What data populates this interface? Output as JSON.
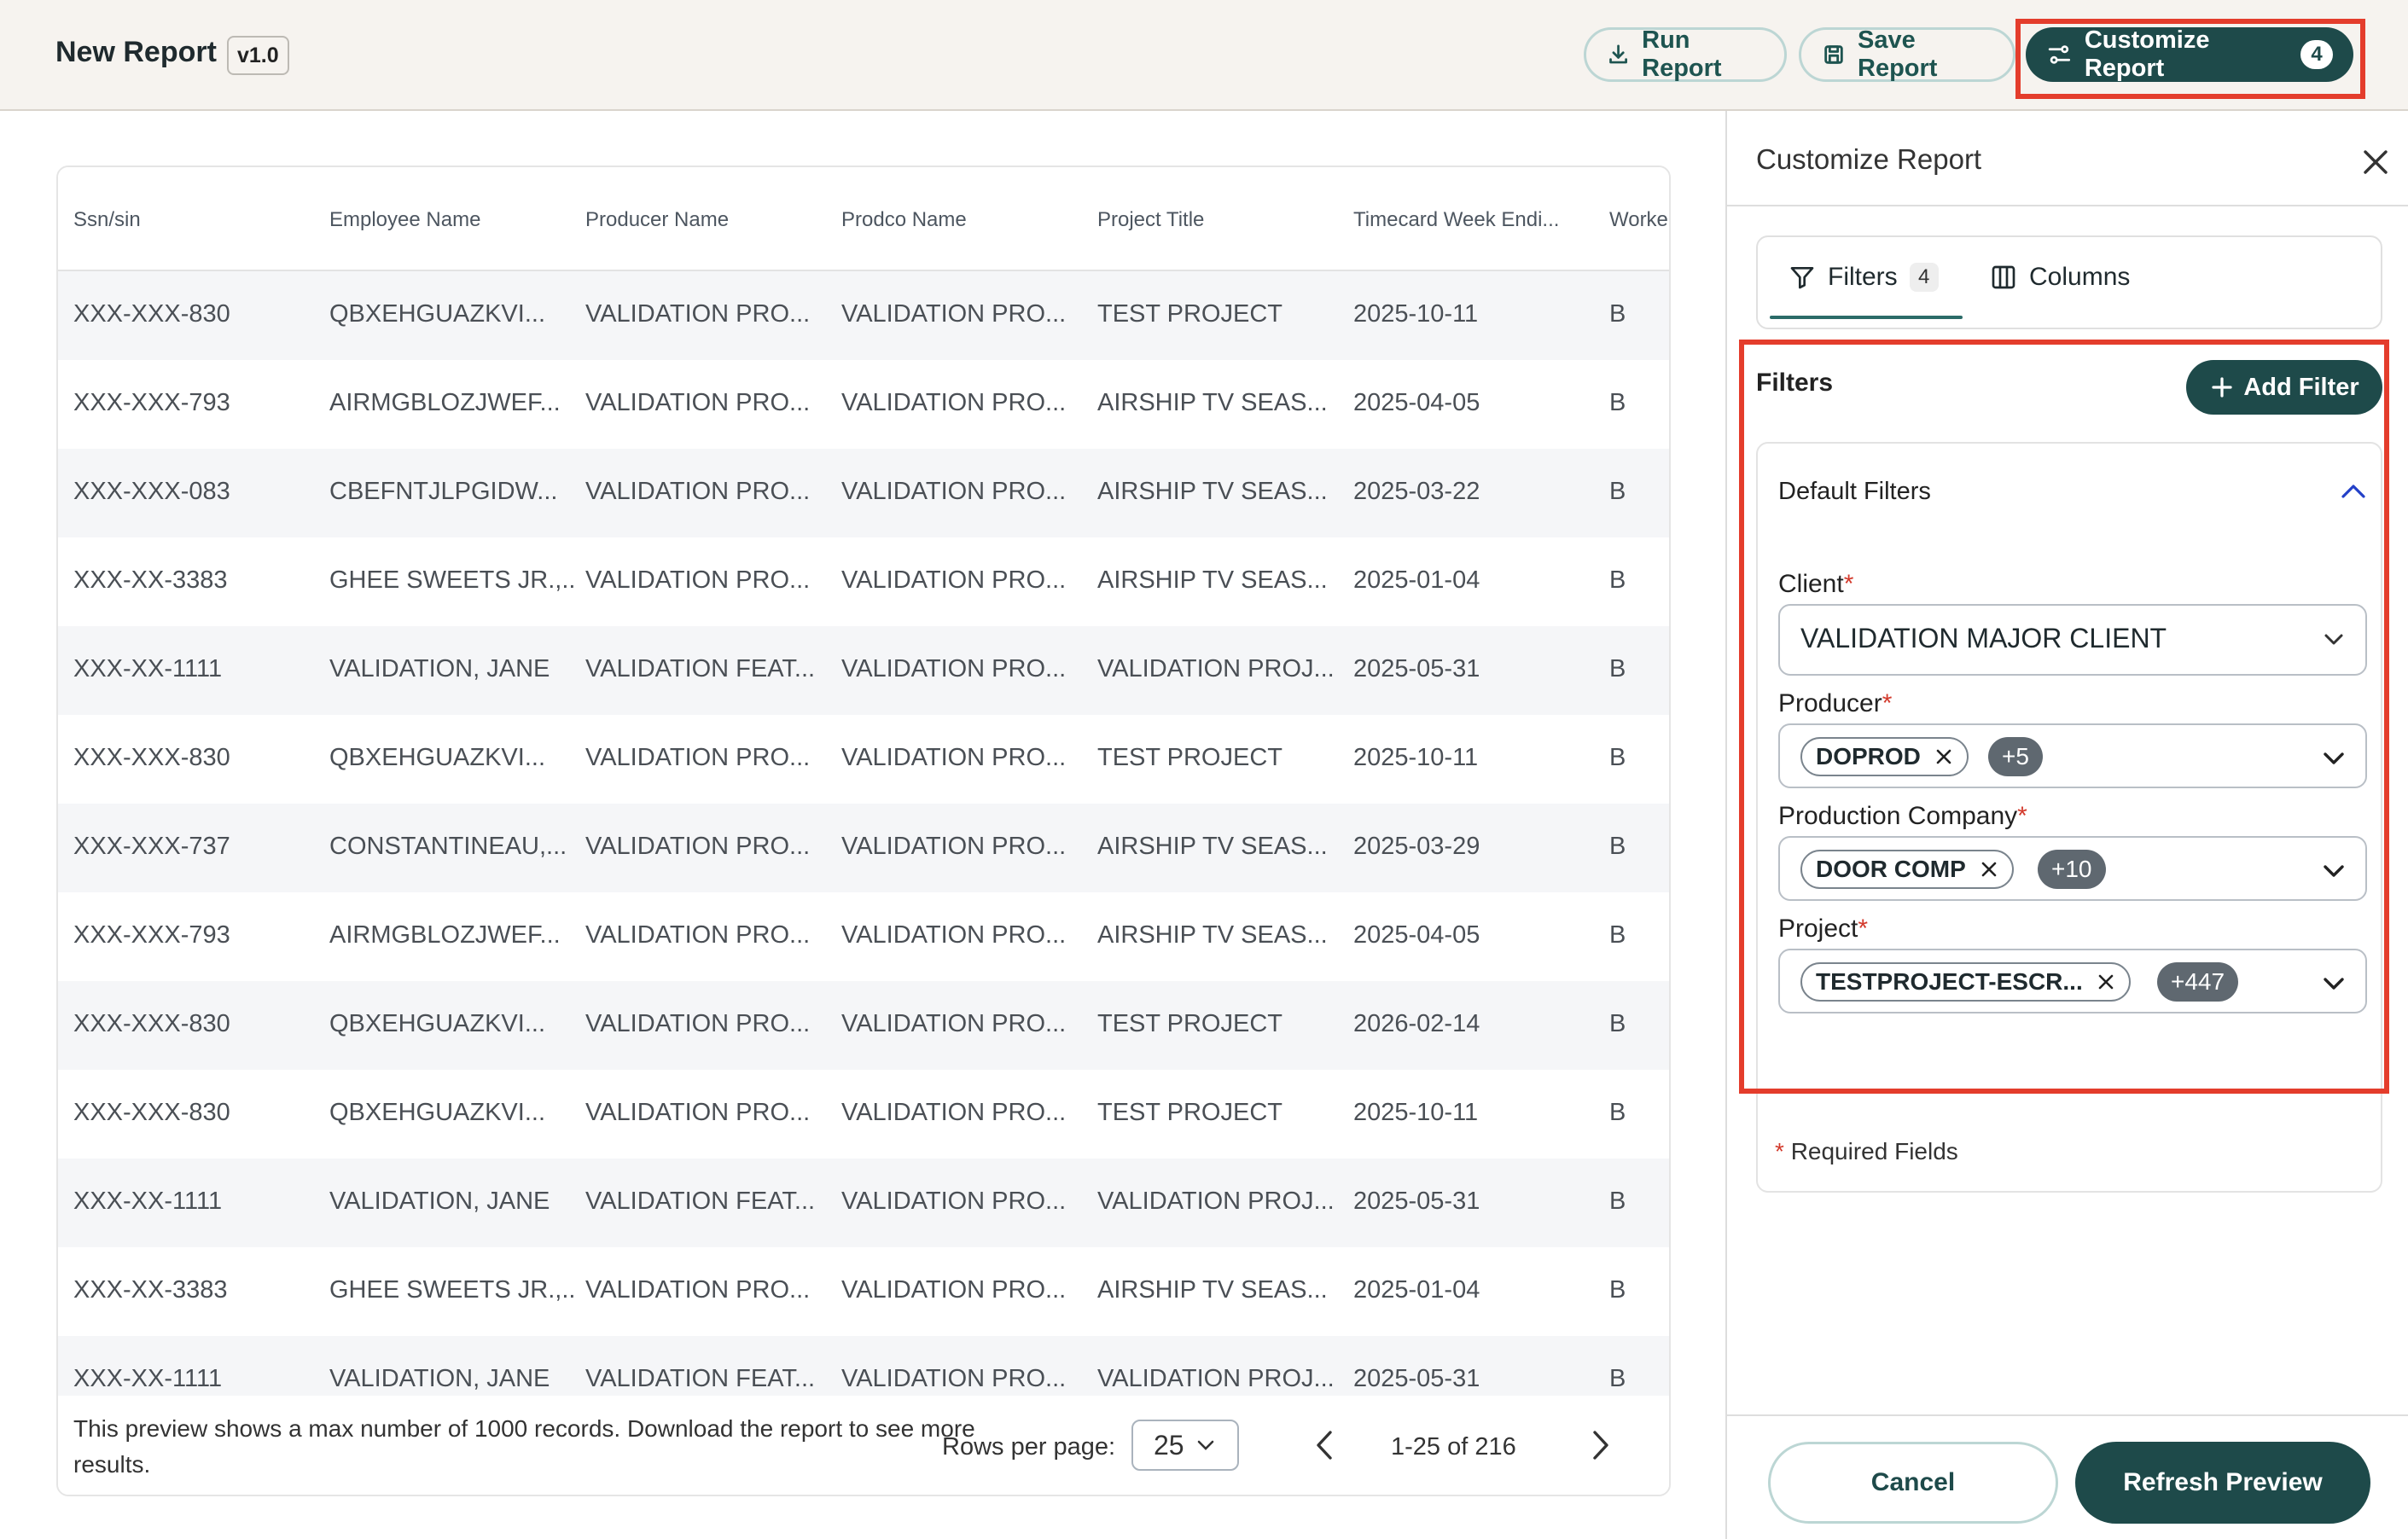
{
  "header": {
    "title": "New Report",
    "version": "v1.0",
    "run_label": "Run Report",
    "save_label": "Save Report",
    "customize_label": "Customize Report",
    "customize_count": "4"
  },
  "table": {
    "columns": [
      "Ssn/sin",
      "Employee Name",
      "Producer Name",
      "Prodco Name",
      "Project Title",
      "Timecard Week Endi...",
      "Worke"
    ],
    "rows": [
      [
        "XXX-XXX-830",
        "QBXEHGUAZKVI...",
        "VALIDATION PRO...",
        "VALIDATION PRO...",
        "TEST PROJECT",
        "2025-10-11",
        "B"
      ],
      [
        "XXX-XXX-793",
        "AIRMGBLOZJWEF...",
        "VALIDATION PRO...",
        "VALIDATION PRO...",
        "AIRSHIP TV SEAS...",
        "2025-04-05",
        "B"
      ],
      [
        "XXX-XXX-083",
        "CBEFNTJLPGIDW...",
        "VALIDATION PRO...",
        "VALIDATION PRO...",
        "AIRSHIP TV SEAS...",
        "2025-03-22",
        "B"
      ],
      [
        "XXX-XX-3383",
        "GHEE SWEETS JR.,...",
        "VALIDATION PRO...",
        "VALIDATION PRO...",
        "AIRSHIP TV SEAS...",
        "2025-01-04",
        "B"
      ],
      [
        "XXX-XX-1111",
        "VALIDATION, JANE",
        "VALIDATION FEAT...",
        "VALIDATION PRO...",
        "VALIDATION PROJ...",
        "2025-05-31",
        "B"
      ],
      [
        "XXX-XXX-830",
        "QBXEHGUAZKVI...",
        "VALIDATION PRO...",
        "VALIDATION PRO...",
        "TEST PROJECT",
        "2025-10-11",
        "B"
      ],
      [
        "XXX-XXX-737",
        "CONSTANTINEAU,...",
        "VALIDATION PRO...",
        "VALIDATION PRO...",
        "AIRSHIP TV SEAS...",
        "2025-03-29",
        "B"
      ],
      [
        "XXX-XXX-793",
        "AIRMGBLOZJWEF...",
        "VALIDATION PRO...",
        "VALIDATION PRO...",
        "AIRSHIP TV SEAS...",
        "2025-04-05",
        "B"
      ],
      [
        "XXX-XXX-830",
        "QBXEHGUAZKVI...",
        "VALIDATION PRO...",
        "VALIDATION PRO...",
        "TEST PROJECT",
        "2026-02-14",
        "B"
      ],
      [
        "XXX-XXX-830",
        "QBXEHGUAZKVI...",
        "VALIDATION PRO...",
        "VALIDATION PRO...",
        "TEST PROJECT",
        "2025-10-11",
        "B"
      ],
      [
        "XXX-XX-1111",
        "VALIDATION, JANE",
        "VALIDATION FEAT...",
        "VALIDATION PRO...",
        "VALIDATION PROJ...",
        "2025-05-31",
        "B"
      ],
      [
        "XXX-XX-3383",
        "GHEE SWEETS JR.,...",
        "VALIDATION PRO...",
        "VALIDATION PRO...",
        "AIRSHIP TV SEAS...",
        "2025-01-04",
        "B"
      ],
      [
        "XXX-XX-1111",
        "VALIDATION, JANE",
        "VALIDATION FEAT...",
        "VALIDATION PRO...",
        "VALIDATION PROJ...",
        "2025-05-31",
        "B"
      ]
    ],
    "note": "This preview shows a max number of 1000 records. Download the report to see more results.",
    "rows_per_page_label": "Rows per page:",
    "rows_per_page_value": "25",
    "page_range": "1-25 of 216"
  },
  "panel": {
    "title": "Customize Report",
    "tab_filters_label": "Filters",
    "tab_filters_count": "4",
    "tab_columns_label": "Columns",
    "filters_heading": "Filters",
    "add_filter_label": "Add Filter",
    "default_filters_title": "Default Filters",
    "client": {
      "label": "Client",
      "value": "VALIDATION MAJOR CLIENT"
    },
    "producer": {
      "label": "Producer",
      "chip": "DOPROD",
      "more": "+5"
    },
    "production_company": {
      "label": "Production Company",
      "chip": "DOOR COMP",
      "more": "+10"
    },
    "project": {
      "label": "Project",
      "chip": "TESTPROJECT-ESCR...",
      "more": "+447"
    },
    "required_star": "*",
    "required_note": "Required Fields",
    "cancel_label": "Cancel",
    "refresh_label": "Refresh Preview"
  },
  "colors": {
    "primary": "#1e4a4a",
    "highlight": "#e43d2c",
    "required": "#d33a2c"
  },
  "icons": [
    "download-icon",
    "save-icon",
    "sliders-icon",
    "close-icon",
    "filter-icon",
    "columns-icon",
    "plus-icon",
    "chevron-up-icon",
    "chevron-down-icon",
    "chip-remove-icon",
    "chevron-left-icon",
    "chevron-right-icon"
  ]
}
